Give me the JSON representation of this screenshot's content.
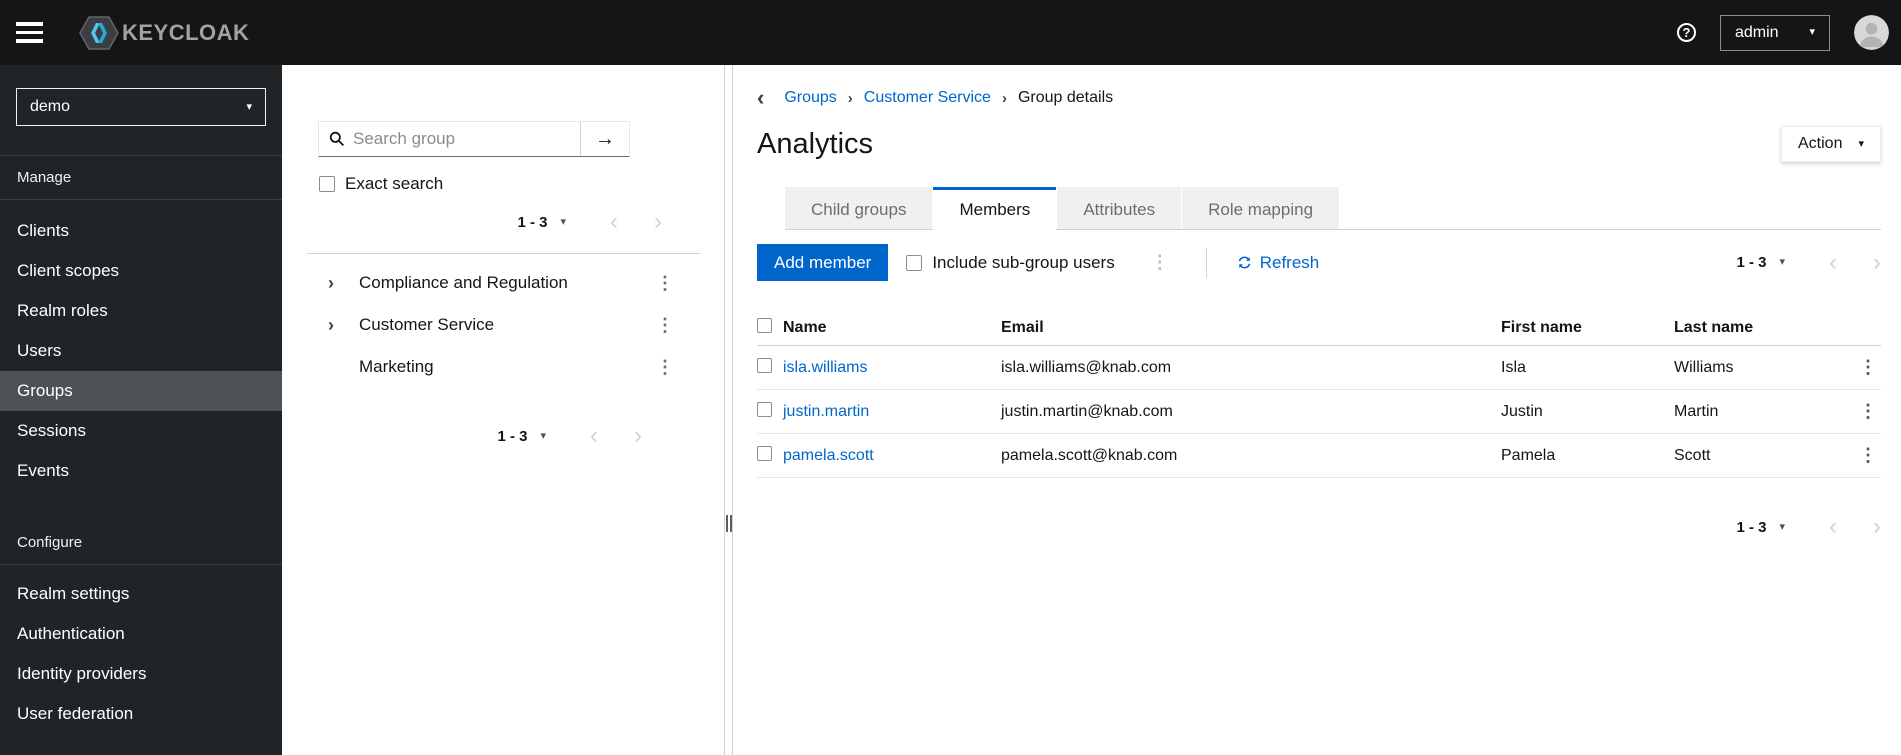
{
  "masthead": {
    "brand": "KEYCLOAK",
    "username": "admin"
  },
  "sidebar": {
    "realm": "demo",
    "sections": [
      {
        "label": "Manage",
        "items": [
          {
            "label": "Clients"
          },
          {
            "label": "Client scopes"
          },
          {
            "label": "Realm roles"
          },
          {
            "label": "Users"
          },
          {
            "label": "Groups",
            "current": true
          },
          {
            "label": "Sessions"
          },
          {
            "label": "Events"
          }
        ]
      },
      {
        "label": "Configure",
        "items": [
          {
            "label": "Realm settings"
          },
          {
            "label": "Authentication"
          },
          {
            "label": "Identity providers"
          },
          {
            "label": "User federation"
          }
        ]
      }
    ]
  },
  "tree_panel": {
    "search_placeholder": "Search group",
    "exact_search_label": "Exact search",
    "pagination_top": "1 - 3",
    "pagination_bottom": "1 - 3",
    "groups": [
      {
        "label": "Compliance and Regulation",
        "expandable": true
      },
      {
        "label": "Customer Service",
        "expandable": true
      },
      {
        "label": "Marketing",
        "expandable": false
      }
    ]
  },
  "main": {
    "breadcrumb": {
      "items": [
        "Groups",
        "Customer Service",
        "Group details"
      ]
    },
    "title": "Analytics",
    "action_label": "Action",
    "tabs": [
      {
        "label": "Child groups",
        "active": false
      },
      {
        "label": "Members",
        "active": true
      },
      {
        "label": "Attributes",
        "active": false
      },
      {
        "label": "Role mapping",
        "active": false
      }
    ],
    "toolbar": {
      "add_member_label": "Add member",
      "include_subgroups_label": "Include sub-group users",
      "refresh_label": "Refresh",
      "pagination": "1 - 3"
    },
    "table": {
      "headers": [
        "Name",
        "Email",
        "First name",
        "Last name"
      ],
      "rows": [
        {
          "name": "isla.williams",
          "email": "isla.williams@knab.com",
          "first": "Isla",
          "last": "Williams"
        },
        {
          "name": "justin.martin",
          "email": "justin.martin@knab.com",
          "first": "Justin",
          "last": "Martin"
        },
        {
          "name": "pamela.scott",
          "email": "pamela.scott@knab.com",
          "first": "Pamela",
          "last": "Scott"
        }
      ]
    },
    "pagination_bottom": "1 - 3"
  },
  "icons": {
    "help": "?",
    "caret_down": "▾",
    "kebab": "⋮",
    "angle_left": "‹",
    "angle_right": "›",
    "back": "‹",
    "breadcrumb_separator": "›",
    "tree_chevron_right": "›",
    "search_arrow_right": "→"
  },
  "colors": {
    "accent_blue": "#0066cc",
    "masthead_bg": "#151515",
    "sidebar_bg": "#212427",
    "sidebar_selected_bg": "#4f5255",
    "inactive_tab_bg": "#f0f0f0",
    "border": "#d2d2d2"
  }
}
